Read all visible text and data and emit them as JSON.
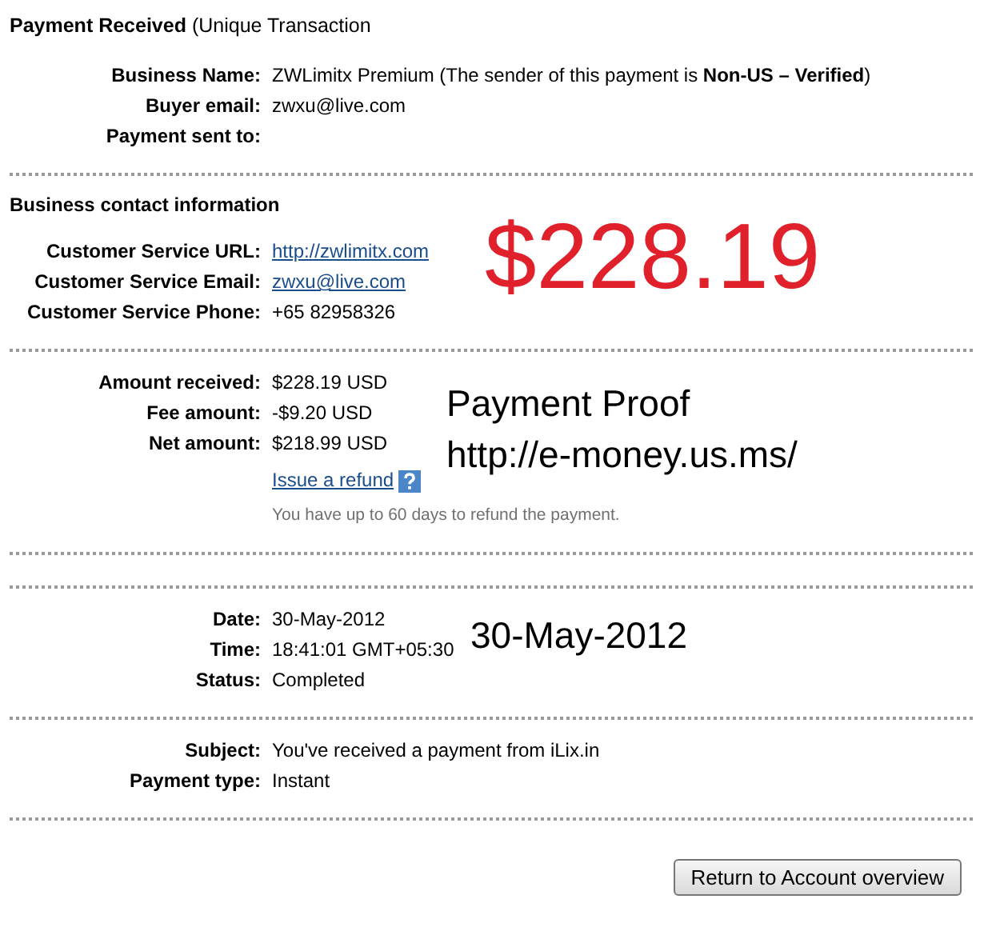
{
  "title": "**Payment Received** (Unique Transaction",
  "sections": [
    {
      "rows": [
        {
          "label": "Business Name:",
          "value": "ZWLimitx Premium (The sender of this payment is **Non-US – Verified**)",
          "kind": "text"
        },
        {
          "label": "Buyer email:",
          "value": "zwxu@live.com",
          "kind": "text"
        },
        {
          "label": "Payment sent to:"
        }
      ]
    },
    {
      "heading": "Business contact information",
      "rows": [
        {
          "label": "Customer Service URL:",
          "value": "http://zwlimitx.com",
          "kind": "link"
        },
        {
          "label": "Customer Service Email:",
          "value": "zwxu@live.com",
          "kind": "link"
        },
        {
          "label": "Customer Service Phone:",
          "value": "+65 82958326",
          "kind": "text"
        }
      ]
    },
    {
      "rows": [
        {
          "label": "Amount received:",
          "value": "$228.19 USD",
          "kind": "text"
        },
        {
          "label": "Fee amount:",
          "value": "-$9.20 USD",
          "kind": "text"
        },
        {
          "label": "Net amount:",
          "value": "$218.99 USD",
          "kind": "text"
        }
      ],
      "refund": {
        "link": "Issue a refund",
        "note": "You have up to 60 days to refund the payment."
      }
    },
    {
      "kind": "blank"
    },
    {
      "rows": [
        {
          "label": "Date:",
          "value": "30-May-2012",
          "kind": "text"
        },
        {
          "label": "Time:",
          "value": "18:41:01 GMT+05:30",
          "kind": "text"
        },
        {
          "label": "Status:",
          "value": "Completed",
          "kind": "text"
        }
      ]
    },
    {
      "rows": [
        {
          "label": "Subject:",
          "value": "You've received a payment from iLix.in",
          "kind": "text"
        },
        {
          "label": "Payment type:",
          "value": "Instant",
          "kind": "text"
        }
      ]
    }
  ],
  "button": "Return to Account overview",
  "annotations": [
    {
      "kind": "amount",
      "text": "$228.19"
    },
    {
      "kind": "caption",
      "text": "Payment Proof"
    },
    {
      "kind": "caption",
      "text": "http://e-money.us.ms/"
    },
    {
      "kind": "caption",
      "text": "30-May-2012"
    }
  ]
}
